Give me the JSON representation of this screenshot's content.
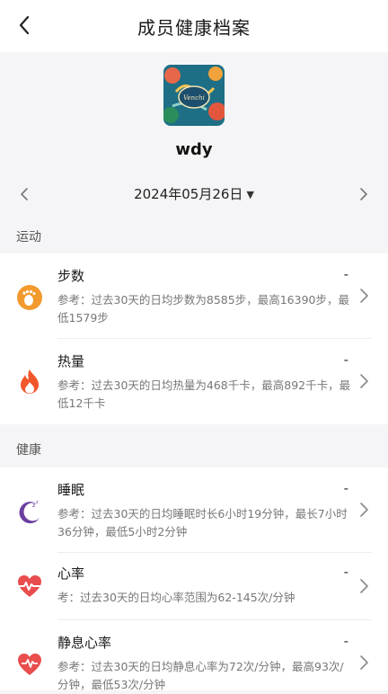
{
  "header": {
    "title": "成员健康档案"
  },
  "profile": {
    "username": "wdy"
  },
  "date": {
    "label": "2024年05月26日"
  },
  "sections": {
    "sport": {
      "label": "运动"
    },
    "health": {
      "label": "健康"
    }
  },
  "items": {
    "steps": {
      "title": "步数",
      "value": "-",
      "desc": "参考：过去30天的日均步数为8585步，最高16390步，最低1579步"
    },
    "calories": {
      "title": "热量",
      "value": "-",
      "desc": "参考：过去30天的日均热量为468千卡，最高892千卡，最低12千卡"
    },
    "sleep": {
      "title": "睡眠",
      "value": "-",
      "desc": "参考：过去30天的日均睡眠时长6小时19分钟，最长7小时36分钟，最低5小时2分钟"
    },
    "heart_rate": {
      "title": "心率",
      "value": "-",
      "desc": "考：过去30天的日均心率范围为62-145次/分钟"
    },
    "resting_hr": {
      "title": "静息心率",
      "value": "-",
      "desc": "参考：过去30天的日均静息心率为72次/分钟，最高93次/分钟，最低53次/分钟"
    }
  },
  "icons": {
    "back": "chevron-left-icon",
    "date_prev": "chevron-left-icon",
    "date_next": "chevron-right-icon",
    "steps": "footprint-icon",
    "calories": "flame-icon",
    "sleep": "moon-icon",
    "heart_rate": "heart-pulse-icon",
    "resting_hr": "heart-icon"
  },
  "colors": {
    "steps": "#f29a2e",
    "calories": "#f2572b",
    "sleep": "#6b3fa0",
    "heart_rate": "#e94d4d",
    "resting_hr": "#e94d4d"
  }
}
